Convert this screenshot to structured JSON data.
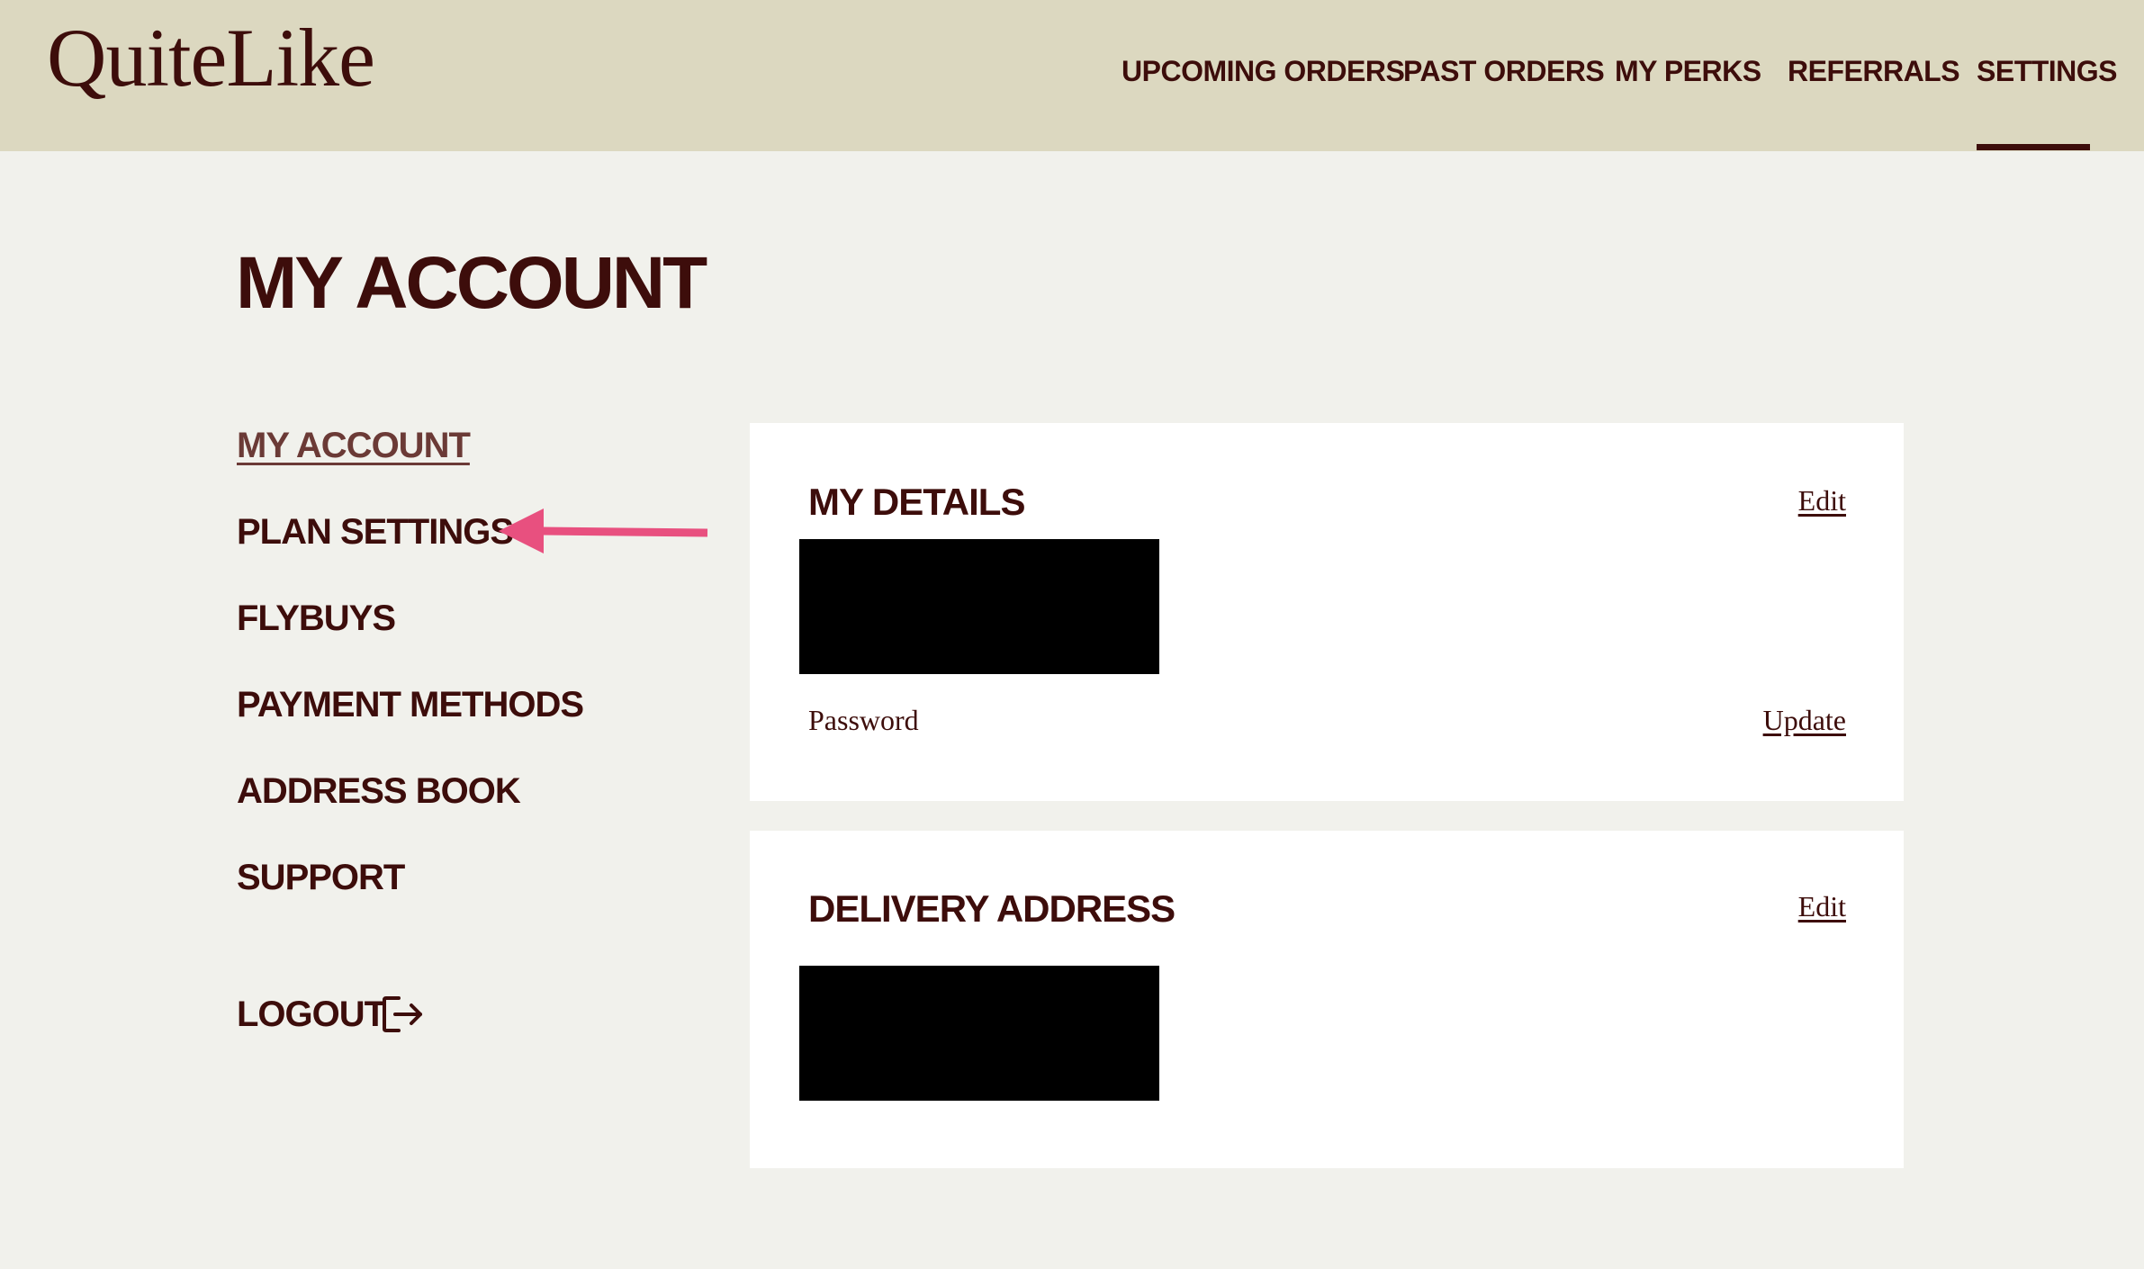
{
  "header": {
    "logo": "QuiteLike",
    "nav": [
      {
        "label": "UPCOMING ORDERS"
      },
      {
        "label": "PAST ORDERS"
      },
      {
        "label": "MY PERKS"
      },
      {
        "label": "REFERRALS"
      },
      {
        "label": "SETTINGS",
        "active": true
      }
    ]
  },
  "page": {
    "title": "MY ACCOUNT"
  },
  "sidebar": {
    "items": [
      {
        "label": "MY ACCOUNT",
        "active": true
      },
      {
        "label": "PLAN SETTINGS"
      },
      {
        "label": "FLYBUYS"
      },
      {
        "label": "PAYMENT METHODS"
      },
      {
        "label": "ADDRESS BOOK"
      },
      {
        "label": "SUPPORT"
      }
    ],
    "logout": "LOGOUT",
    "logout_icon": "logout-icon",
    "annotation_arrow_color": "#e8507f"
  },
  "details_card": {
    "title": "MY DETAILS",
    "edit_label": "Edit",
    "password_label": "Password",
    "update_label": "Update"
  },
  "delivery_card": {
    "title": "DELIVERY ADDRESS",
    "edit_label": "Edit"
  },
  "colors": {
    "header_bg": "#dcd8c0",
    "page_bg": "#f1f1ec",
    "text": "#3d0d0b",
    "card_bg": "#ffffff",
    "arrow": "#e8507f"
  }
}
